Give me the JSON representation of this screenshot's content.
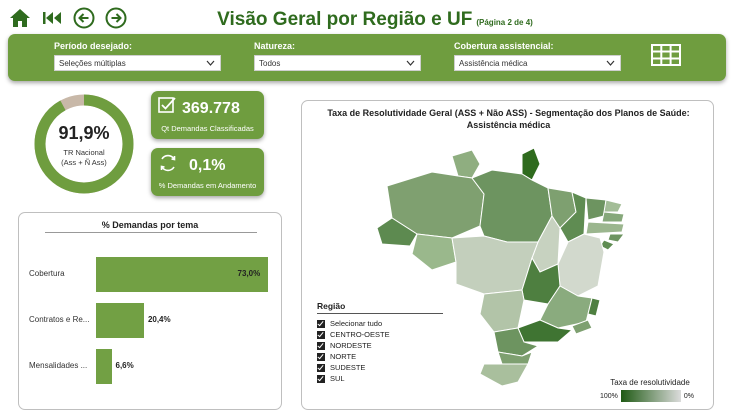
{
  "header": {
    "title": "Visão Geral por Região e UF",
    "page_note": "(Página 2 de 4)"
  },
  "nav": {
    "icons": [
      "home-icon",
      "first-page-icon",
      "back-arrow-icon",
      "forward-arrow-icon"
    ]
  },
  "filters": {
    "periodo": {
      "label": "Período desejado:",
      "value": "Seleções múltiplas"
    },
    "natureza": {
      "label": "Natureza:",
      "value": "Todos"
    },
    "cobertura": {
      "label": "Cobertura assistencial:",
      "value": "Assistência médica"
    }
  },
  "donut": {
    "value_text": "91,9%",
    "value": 91.9,
    "label_line1": "TR Nacional",
    "label_line2": "(Ass + Ñ Ass)"
  },
  "kpis": {
    "demandas_classificadas": {
      "value": "369.778",
      "caption": "Qt Demandas Classificadas",
      "icon": "checkbox-icon"
    },
    "demandas_andamento": {
      "value": "0,1%",
      "caption": "% Demandas em Andamento",
      "icon": "refresh-icon"
    }
  },
  "demandas_tema": {
    "title": "% Demandas por tema",
    "rows": [
      {
        "category": "Cobertura",
        "value": 73.0,
        "label": "73,0%"
      },
      {
        "category": "Contratos e Re...",
        "value": 20.4,
        "label": "20,4%"
      },
      {
        "category": "Mensalidades ...",
        "value": 6.6,
        "label": "6,6%"
      }
    ]
  },
  "map": {
    "title_line1": "Taxa de Resolutividade Geral (ASS + Não ASS) - Segmentação dos Planos de Saúde:",
    "title_line2": "Assistência médica",
    "legend_title": "Região",
    "legend_items": [
      "Selecionar tudo",
      "CENTRO-OESTE",
      "NORDESTE",
      "NORTE",
      "SUDESTE",
      "SUL"
    ],
    "scale_title": "Taxa de resolutividade",
    "scale_min": "100%",
    "scale_max": "0%",
    "colors": {
      "dark": "#1f5a14",
      "light": "#dcdcdc",
      "accent": "#6f9d3f"
    }
  }
}
